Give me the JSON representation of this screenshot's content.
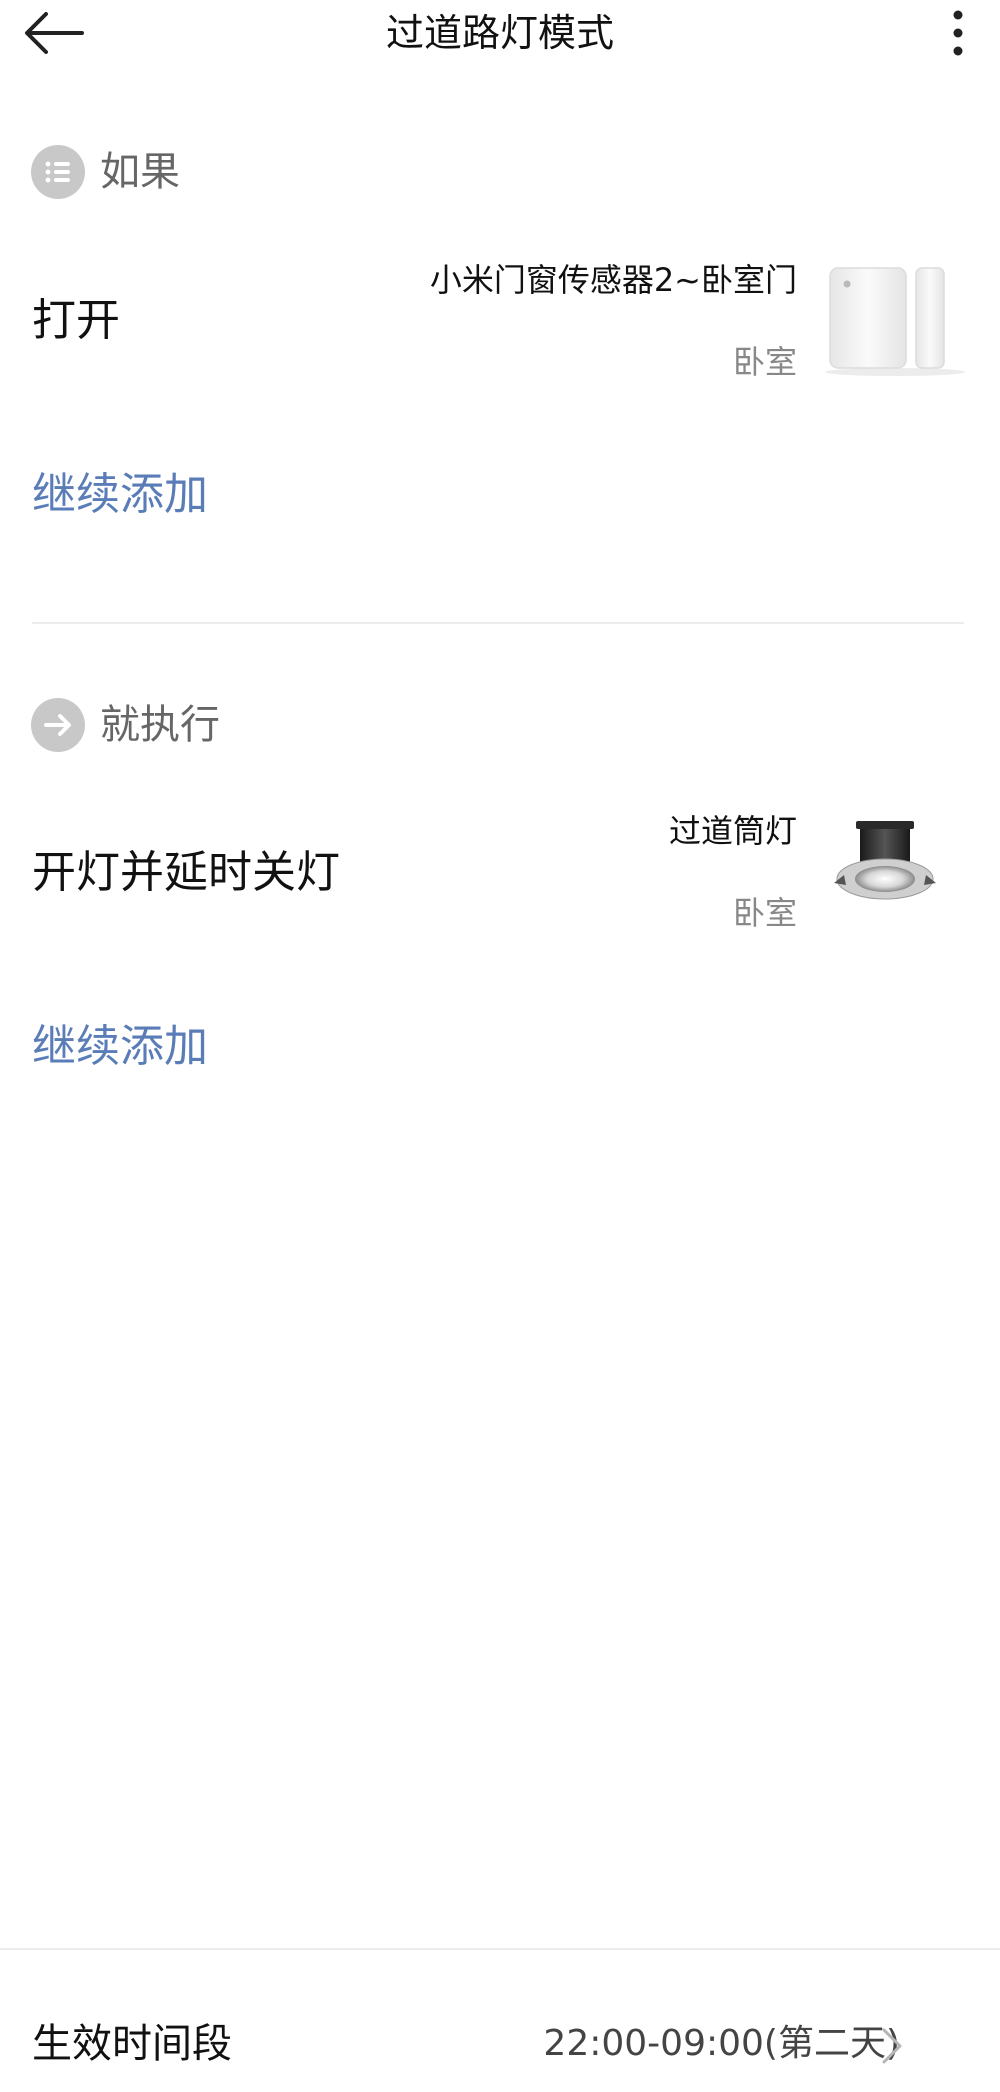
{
  "header": {
    "title": "过道路灯模式",
    "back_icon": "arrow-left-icon",
    "more_icon": "more-vertical-icon"
  },
  "if_section": {
    "icon": "list-icon",
    "label": "如果",
    "condition": {
      "text": "打开",
      "device_name": "小米门窗传感器2~卧室门",
      "room": "卧室",
      "device_image": "door-window-sensor-icon"
    },
    "add_label": "继续添加"
  },
  "then_section": {
    "icon": "arrow-right-icon",
    "label": "就执行",
    "action": {
      "text": "开灯并延时关灯",
      "device_name": "过道筒灯",
      "room": "卧室",
      "device_image": "downlight-icon"
    },
    "add_label": "继续添加"
  },
  "footer": {
    "label": "生效时间段",
    "value": "22:00-09:00(第二天)",
    "chevron_icon": "chevron-right-icon"
  },
  "colors": {
    "accent": "#5a7db8",
    "icon_bg": "#c8c8c8",
    "divider": "#ececec"
  }
}
